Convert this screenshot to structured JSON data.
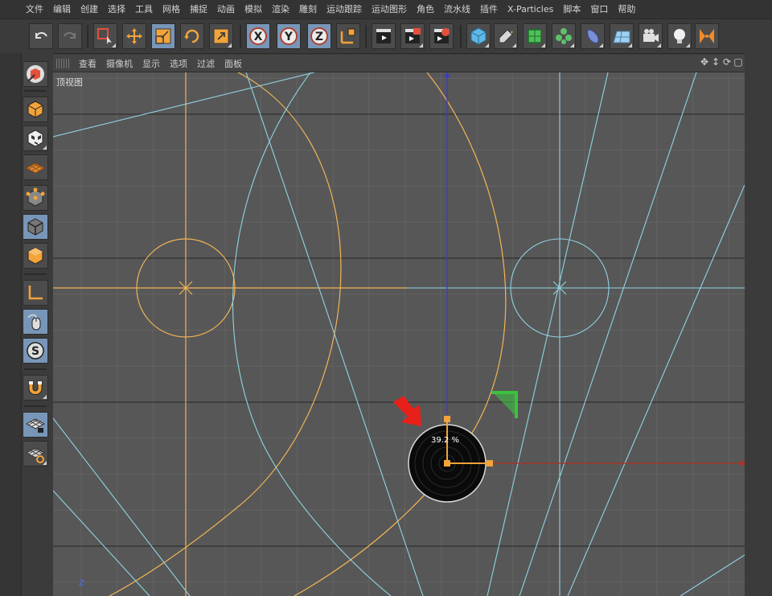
{
  "menu": [
    "文件",
    "编辑",
    "创建",
    "选择",
    "工具",
    "网格",
    "捕捉",
    "动画",
    "模拟",
    "渲染",
    "雕刻",
    "运动跟踪",
    "运动图形",
    "角色",
    "流水线",
    "插件",
    "X-Particles",
    "脚本",
    "窗口",
    "帮助"
  ],
  "toolbar": {
    "undo": "undo-icon",
    "redo": "redo-icon",
    "live_select": "live-selection-icon",
    "move": "move-icon",
    "scale": "scale-icon",
    "rotate": "rotate-icon",
    "recent": "recent-tool-icon",
    "x_label": "X",
    "y_label": "Y",
    "z_label": "Z",
    "coord": "coordinate-system-icon",
    "render_view": "render-view-icon",
    "render_picture": "render-picture-icon",
    "render_settings": "render-settings-icon",
    "cube": "cube-icon",
    "pen": "pen-spline-icon",
    "subdivision": "subdivision-surface-icon",
    "cloner": "cloner-icon",
    "deformer": "deformer-icon",
    "floor": "floor-icon",
    "camera": "camera-icon",
    "light": "light-icon",
    "xparticles": "x-particles-icon"
  },
  "viewport": {
    "menu": [
      "查看",
      "摄像机",
      "显示",
      "选项",
      "过滤",
      "面板"
    ],
    "label": "顶视图",
    "percent": "39.2 %",
    "axis_label": "Z"
  },
  "colors": {
    "grid": "#626262",
    "major": "#222222",
    "orange": "#f2b555",
    "cyan": "#8fd3e3",
    "accent": "#7896b8"
  }
}
